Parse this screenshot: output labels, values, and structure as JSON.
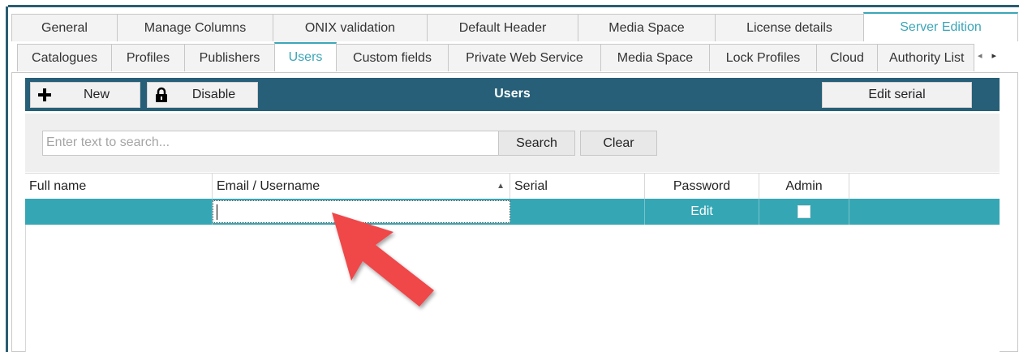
{
  "tabs_row1": [
    {
      "label": "General",
      "active": false
    },
    {
      "label": "Manage Columns",
      "active": false
    },
    {
      "label": "ONIX validation",
      "active": false
    },
    {
      "label": "Default Header",
      "active": false
    },
    {
      "label": "Media Space",
      "active": false
    },
    {
      "label": "License details",
      "active": false
    },
    {
      "label": "Server Edition",
      "active": true
    }
  ],
  "tabs_row2": [
    {
      "label": "Catalogues",
      "active": false
    },
    {
      "label": "Profiles",
      "active": false
    },
    {
      "label": "Publishers",
      "active": false
    },
    {
      "label": "Users",
      "active": true
    },
    {
      "label": "Custom fields",
      "active": false
    },
    {
      "label": "Private Web Service",
      "active": false
    },
    {
      "label": "Media Space",
      "active": false
    },
    {
      "label": "Lock Profiles",
      "active": false
    },
    {
      "label": "Cloud",
      "active": false
    },
    {
      "label": "Authority List",
      "active": false
    }
  ],
  "tab_scroll": {
    "left_icon": "chevron-left-icon",
    "right_icon": "chevron-right-icon"
  },
  "toolbar": {
    "title": "Users",
    "new_label": "New",
    "new_icon": "plus-icon",
    "disable_label": "Disable",
    "disable_icon": "lock-icon",
    "edit_serial_label": "Edit serial",
    "background": "#265f77"
  },
  "search": {
    "placeholder": "Enter text to search...",
    "value": "",
    "search_label": "Search",
    "clear_label": "Clear"
  },
  "grid": {
    "columns": [
      "Full name",
      "Email / Username",
      "Serial",
      "Password",
      "Admin"
    ],
    "sorted_column": "Email / Username",
    "sort_direction": "ascending",
    "rows": [
      {
        "full_name": "",
        "email": "",
        "serial": "",
        "password": "Edit",
        "admin": false
      }
    ],
    "selection_color": "#35a6b4"
  },
  "annotation": {
    "type": "red-arrow-icon",
    "color": "#f0464a"
  }
}
